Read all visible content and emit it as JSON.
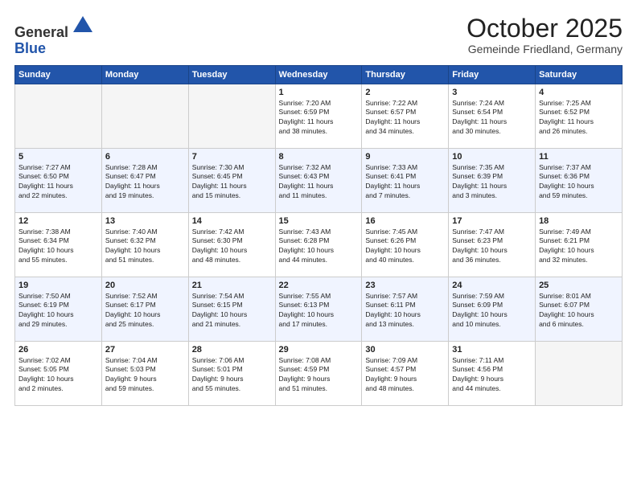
{
  "header": {
    "logo_general": "General",
    "logo_blue": "Blue",
    "month_title": "October 2025",
    "subtitle": "Gemeinde Friedland, Germany"
  },
  "weekdays": [
    "Sunday",
    "Monday",
    "Tuesday",
    "Wednesday",
    "Thursday",
    "Friday",
    "Saturday"
  ],
  "weeks": [
    {
      "alt": false,
      "days": [
        {
          "num": "",
          "info": ""
        },
        {
          "num": "",
          "info": ""
        },
        {
          "num": "",
          "info": ""
        },
        {
          "num": "1",
          "info": "Sunrise: 7:20 AM\nSunset: 6:59 PM\nDaylight: 11 hours\nand 38 minutes."
        },
        {
          "num": "2",
          "info": "Sunrise: 7:22 AM\nSunset: 6:57 PM\nDaylight: 11 hours\nand 34 minutes."
        },
        {
          "num": "3",
          "info": "Sunrise: 7:24 AM\nSunset: 6:54 PM\nDaylight: 11 hours\nand 30 minutes."
        },
        {
          "num": "4",
          "info": "Sunrise: 7:25 AM\nSunset: 6:52 PM\nDaylight: 11 hours\nand 26 minutes."
        }
      ]
    },
    {
      "alt": true,
      "days": [
        {
          "num": "5",
          "info": "Sunrise: 7:27 AM\nSunset: 6:50 PM\nDaylight: 11 hours\nand 22 minutes."
        },
        {
          "num": "6",
          "info": "Sunrise: 7:28 AM\nSunset: 6:47 PM\nDaylight: 11 hours\nand 19 minutes."
        },
        {
          "num": "7",
          "info": "Sunrise: 7:30 AM\nSunset: 6:45 PM\nDaylight: 11 hours\nand 15 minutes."
        },
        {
          "num": "8",
          "info": "Sunrise: 7:32 AM\nSunset: 6:43 PM\nDaylight: 11 hours\nand 11 minutes."
        },
        {
          "num": "9",
          "info": "Sunrise: 7:33 AM\nSunset: 6:41 PM\nDaylight: 11 hours\nand 7 minutes."
        },
        {
          "num": "10",
          "info": "Sunrise: 7:35 AM\nSunset: 6:39 PM\nDaylight: 11 hours\nand 3 minutes."
        },
        {
          "num": "11",
          "info": "Sunrise: 7:37 AM\nSunset: 6:36 PM\nDaylight: 10 hours\nand 59 minutes."
        }
      ]
    },
    {
      "alt": false,
      "days": [
        {
          "num": "12",
          "info": "Sunrise: 7:38 AM\nSunset: 6:34 PM\nDaylight: 10 hours\nand 55 minutes."
        },
        {
          "num": "13",
          "info": "Sunrise: 7:40 AM\nSunset: 6:32 PM\nDaylight: 10 hours\nand 51 minutes."
        },
        {
          "num": "14",
          "info": "Sunrise: 7:42 AM\nSunset: 6:30 PM\nDaylight: 10 hours\nand 48 minutes."
        },
        {
          "num": "15",
          "info": "Sunrise: 7:43 AM\nSunset: 6:28 PM\nDaylight: 10 hours\nand 44 minutes."
        },
        {
          "num": "16",
          "info": "Sunrise: 7:45 AM\nSunset: 6:26 PM\nDaylight: 10 hours\nand 40 minutes."
        },
        {
          "num": "17",
          "info": "Sunrise: 7:47 AM\nSunset: 6:23 PM\nDaylight: 10 hours\nand 36 minutes."
        },
        {
          "num": "18",
          "info": "Sunrise: 7:49 AM\nSunset: 6:21 PM\nDaylight: 10 hours\nand 32 minutes."
        }
      ]
    },
    {
      "alt": true,
      "days": [
        {
          "num": "19",
          "info": "Sunrise: 7:50 AM\nSunset: 6:19 PM\nDaylight: 10 hours\nand 29 minutes."
        },
        {
          "num": "20",
          "info": "Sunrise: 7:52 AM\nSunset: 6:17 PM\nDaylight: 10 hours\nand 25 minutes."
        },
        {
          "num": "21",
          "info": "Sunrise: 7:54 AM\nSunset: 6:15 PM\nDaylight: 10 hours\nand 21 minutes."
        },
        {
          "num": "22",
          "info": "Sunrise: 7:55 AM\nSunset: 6:13 PM\nDaylight: 10 hours\nand 17 minutes."
        },
        {
          "num": "23",
          "info": "Sunrise: 7:57 AM\nSunset: 6:11 PM\nDaylight: 10 hours\nand 13 minutes."
        },
        {
          "num": "24",
          "info": "Sunrise: 7:59 AM\nSunset: 6:09 PM\nDaylight: 10 hours\nand 10 minutes."
        },
        {
          "num": "25",
          "info": "Sunrise: 8:01 AM\nSunset: 6:07 PM\nDaylight: 10 hours\nand 6 minutes."
        }
      ]
    },
    {
      "alt": false,
      "days": [
        {
          "num": "26",
          "info": "Sunrise: 7:02 AM\nSunset: 5:05 PM\nDaylight: 10 hours\nand 2 minutes."
        },
        {
          "num": "27",
          "info": "Sunrise: 7:04 AM\nSunset: 5:03 PM\nDaylight: 9 hours\nand 59 minutes."
        },
        {
          "num": "28",
          "info": "Sunrise: 7:06 AM\nSunset: 5:01 PM\nDaylight: 9 hours\nand 55 minutes."
        },
        {
          "num": "29",
          "info": "Sunrise: 7:08 AM\nSunset: 4:59 PM\nDaylight: 9 hours\nand 51 minutes."
        },
        {
          "num": "30",
          "info": "Sunrise: 7:09 AM\nSunset: 4:57 PM\nDaylight: 9 hours\nand 48 minutes."
        },
        {
          "num": "31",
          "info": "Sunrise: 7:11 AM\nSunset: 4:56 PM\nDaylight: 9 hours\nand 44 minutes."
        },
        {
          "num": "",
          "info": ""
        }
      ]
    }
  ]
}
